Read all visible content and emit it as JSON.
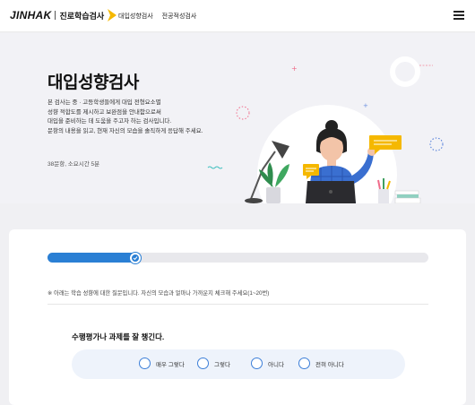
{
  "header": {
    "logo_main": "JINHAK",
    "logo_sub": "진로학습검사",
    "nav": [
      "대입성향검사",
      "전공적성검사"
    ]
  },
  "hero": {
    "title": "대입성향검사",
    "description": [
      "본 검사는 중 · 고등학생들에게 대입 전형요소별",
      "성향 적합도를 제시하고 보완점을 안내함으로써",
      "대입을 준비하는 데 도움을 주고자 하는 검사입니다.",
      "문항의 내용을 읽고, 현재 자신의 모습을 솔직하게 응답해 주세요."
    ],
    "meta": "38문항, 소요시간 5분"
  },
  "survey": {
    "progress_fraction": 0.24,
    "notice": "※ 아래는 학습 성향에 대한 질문입니다. 자신의 모습과 얼마나 가까운지 체크해 주세요(1~20번)",
    "question": "수행평가나 과제를 잘 챙긴다.",
    "options": [
      "매우 그렇다",
      "그렇다",
      "아니다",
      "전혀 아니다"
    ]
  },
  "colors": {
    "accent": "#2a7fd4",
    "logo_chevron": "#f5b800",
    "answer_bg": "#eef3fb"
  },
  "icons": {
    "menu": "hamburger-menu-icon",
    "progress": "check-icon"
  }
}
